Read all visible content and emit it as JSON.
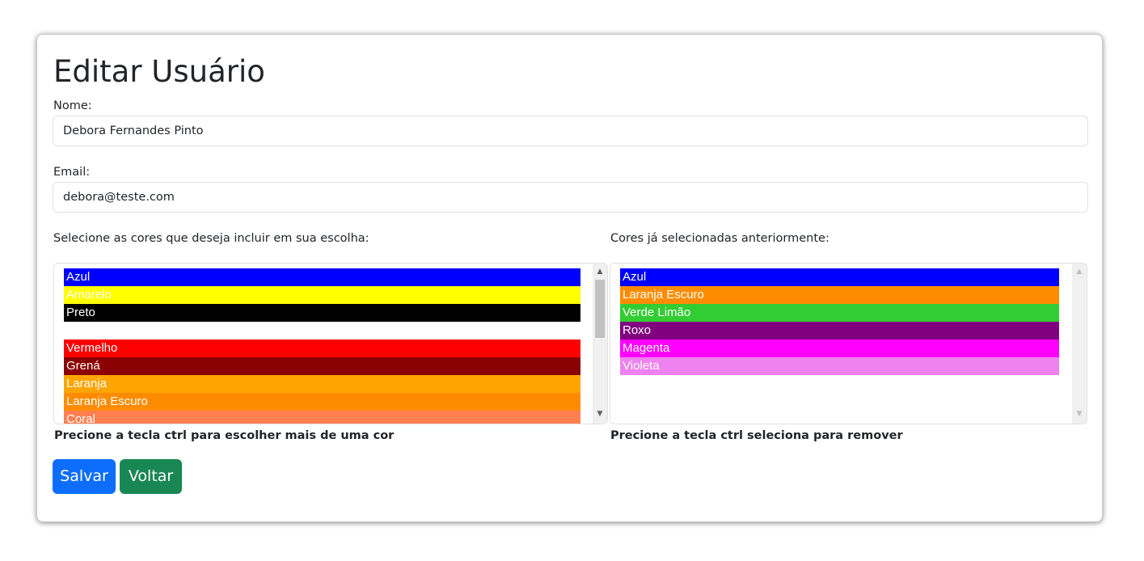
{
  "page_title": "Editar Usuário",
  "nome": {
    "label": "Nome:",
    "value": "Debora Fernandes Pinto"
  },
  "email": {
    "label": "Email:",
    "value": "debora@teste.com"
  },
  "available_colors": {
    "label": "Selecione as cores que deseja incluir em sua escolha:",
    "hint": "Precione a tecla ctrl para escolher mais de uma cor",
    "options": [
      {
        "label": "Azul",
        "color": "#0000ff"
      },
      {
        "label": "Amarelo",
        "color": "#ffff00"
      },
      {
        "label": "Preto",
        "color": "#000000"
      },
      {
        "label": "",
        "color": "#ffffff"
      },
      {
        "label": "Vermelho",
        "color": "#ff0000"
      },
      {
        "label": "Grená",
        "color": "#8b0000"
      },
      {
        "label": "Laranja",
        "color": "#ffa500"
      },
      {
        "label": "Laranja Escuro",
        "color": "#ff8c00"
      },
      {
        "label": "Coral",
        "color": "#ff7f50"
      }
    ]
  },
  "selected_colors": {
    "label": "Cores já selecionadas anteriormente:",
    "hint": "Precione a tecla ctrl seleciona para remover",
    "options": [
      {
        "label": "Azul",
        "color": "#0000ff"
      },
      {
        "label": "Laranja Escuro",
        "color": "#ff8c00"
      },
      {
        "label": "Verde Limão",
        "color": "#32cd32"
      },
      {
        "label": "Roxo",
        "color": "#800080"
      },
      {
        "label": "Magenta",
        "color": "#ff00ff"
      },
      {
        "label": "Violeta",
        "color": "#ee82ee"
      }
    ]
  },
  "buttons": {
    "save_label": "Salvar",
    "save_color": "#0d6efd",
    "back_label": "Voltar",
    "back_color": "#198754"
  }
}
